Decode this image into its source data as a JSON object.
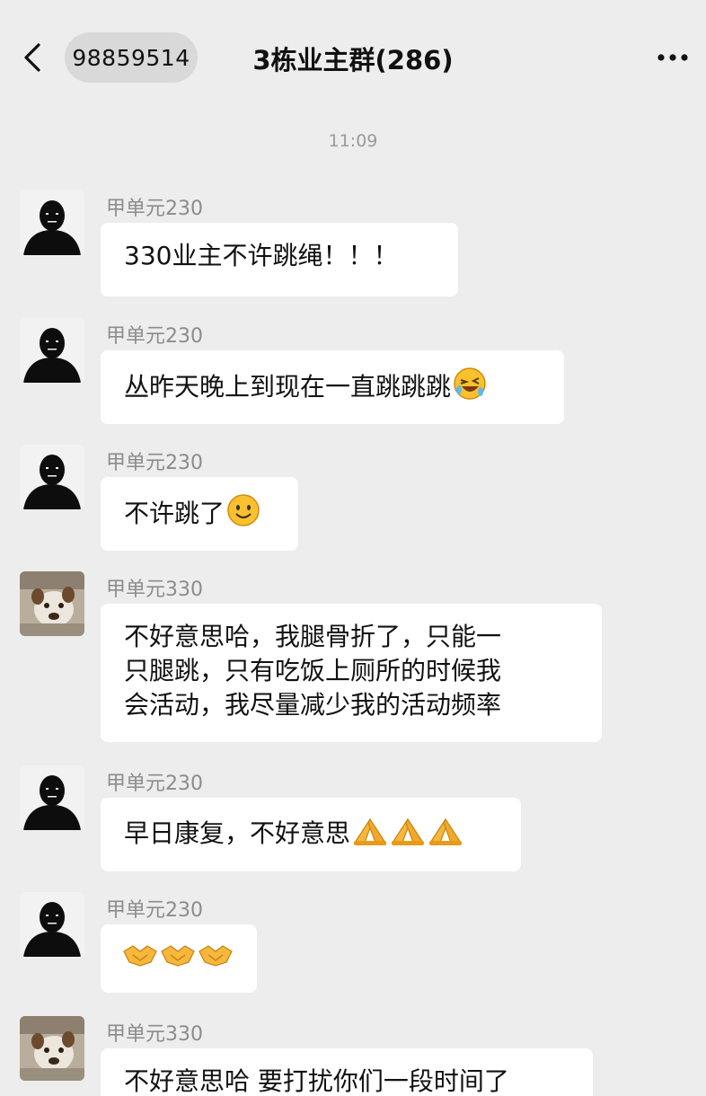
{
  "header": {
    "unread_count": "98859514",
    "title": "3栋业主群(286)"
  },
  "timestamp": "11:09",
  "messages": [
    {
      "sender": "甲单元230",
      "text": "330业主不许跳绳！！！",
      "emoji": []
    },
    {
      "sender": "甲单元230",
      "text": "丛昨天晚上到现在一直跳跳跳",
      "emoji": [
        "laughing-tears-icon"
      ]
    },
    {
      "sender": "甲单元230",
      "text": "不许跳了",
      "emoji": [
        "smile-icon"
      ]
    },
    {
      "sender": "甲单元330",
      "lines": [
        "不好意思哈，我腿骨折了，只能一",
        "只腿跳，只有吃饭上厕所的时候我",
        "会活动，我尽量减少我的活动频率"
      ],
      "emoji": []
    },
    {
      "sender": "甲单元230",
      "text": "早日康复，不好意思",
      "emoji": [
        "pray-icon",
        "pray-icon",
        "pray-icon"
      ]
    },
    {
      "sender": "甲单元230",
      "text": "",
      "emoji": [
        "handshake-icon",
        "handshake-icon",
        "handshake-icon"
      ]
    },
    {
      "sender": "甲单元330",
      "text": "不好意思哈 要打扰你们一段时间了",
      "emoji": []
    }
  ]
}
